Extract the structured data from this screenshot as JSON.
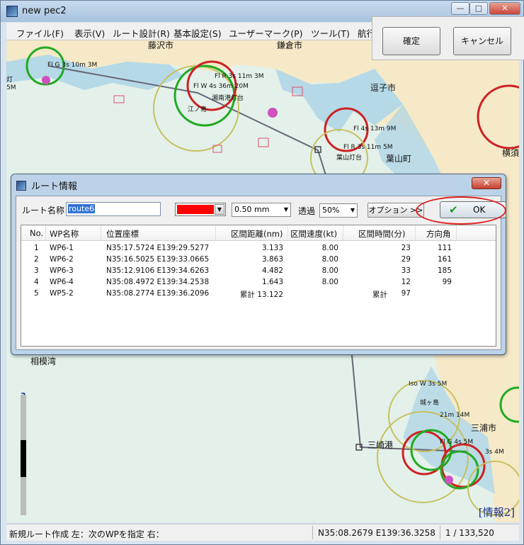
{
  "window": {
    "title": "new pec2",
    "minimize": "—",
    "maximize": "□",
    "close": "✕"
  },
  "menu": [
    "ファイル(F)",
    "表示(V)",
    "ルート設計(R)",
    "基本設定(S)",
    "ユーザーマーク(P)",
    "ツール(T)",
    "航行"
  ],
  "confirm_panel": {
    "ok_label": "確定",
    "cancel_label": "キャンセル"
  },
  "map": {
    "labels": {
      "fujisawa": "藤沢市",
      "kamakura": "鎌倉市",
      "zushi": "逗子市",
      "hayama": "葉山町",
      "sagami_bay": "相模湾",
      "miura": "三浦市",
      "misaki": "三崎港",
      "enoshima": "江ノ島",
      "light1": "Fl G 3s 10m 3M",
      "light2": "Fl R 3s 11m 3M",
      "light3": "Fl W 4s 36m 20M",
      "light4": "Fl 4s 13m 9M",
      "light5": "Fl R 3s 11m 5M",
      "light6": "Iso W 3s 5M",
      "light7": "21m 14M",
      "light8": "Fl G 4s 5M",
      "light9": "3s 4M",
      "yokosuka": "横須",
      "hiratsuka_tou": "灯",
      "hiratsuka_5m": "5M",
      "shonan_light": "湘南港灯台",
      "hayama_light": "葉山灯台",
      "jogashima": "城ヶ島"
    },
    "info_label": "[情報2]",
    "scale_level": "3"
  },
  "route_dialog": {
    "title": "ルート情報",
    "close_label": "✕",
    "route_name_label": "ルート名称",
    "route_name_value": "route6",
    "line_width_value": "0.50 mm",
    "transparency_label": "透過",
    "transparency_value": "50%",
    "option_button": "オプション >>",
    "ok_button": "OK",
    "columns": [
      "No.",
      "WP名称",
      "位置座標",
      "区間距離(nm)",
      "区間速度(kt)",
      "区間時間(分)",
      "方向角"
    ],
    "rows": [
      {
        "no": "1",
        "wp": "WP6-1",
        "pos": "N35:17.5724  E139:29.5277",
        "dist": "3.133",
        "speed": "8.00",
        "time": "23",
        "dir": "111"
      },
      {
        "no": "2",
        "wp": "WP6-2",
        "pos": "N35:16.5025  E139:33.0665",
        "dist": "3.863",
        "speed": "8.00",
        "time": "29",
        "dir": "161"
      },
      {
        "no": "3",
        "wp": "WP6-3",
        "pos": "N35:12.9106  E139:34.6263",
        "dist": "4.482",
        "speed": "8.00",
        "time": "33",
        "dir": "185"
      },
      {
        "no": "4",
        "wp": "WP6-4",
        "pos": "N35:08.4972  E139:34.2538",
        "dist": "1.643",
        "speed": "8.00",
        "time": "12",
        "dir": "99"
      },
      {
        "no": "5",
        "wp": "WP5-2",
        "pos": "N35:08.2774  E139:36.2096",
        "dist": "累計 13.122",
        "speed": "",
        "time": "97",
        "time_prefix": "累計",
        "dir": ""
      }
    ]
  },
  "status": {
    "hint": "新規ルート作成 左：次のWPを指定 右：",
    "coords": "N35:08.2679 E139:36.3258",
    "scale": "1 / 133,520"
  },
  "colors": {
    "route_color": "#ff0000",
    "land": "#f5e9c8",
    "sea": "#e3f1ea",
    "shallow": "#a9d3e6"
  }
}
